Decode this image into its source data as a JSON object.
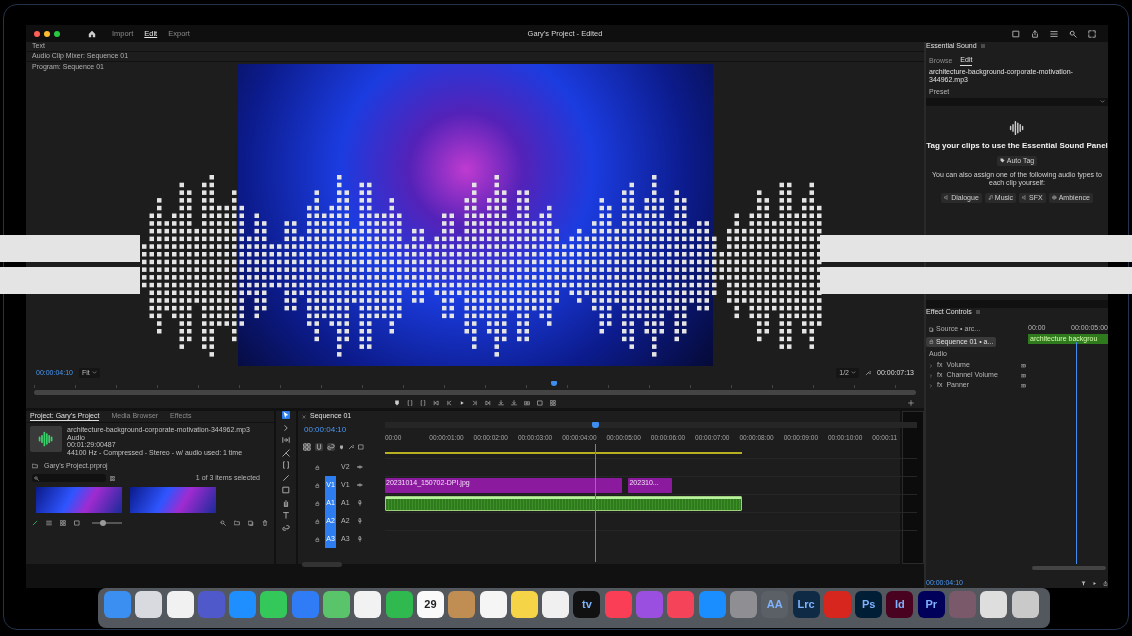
{
  "window": {
    "title": "Gary's Project - Edited"
  },
  "workspaces": [
    {
      "label": "Import",
      "selected": false
    },
    {
      "label": "Edit",
      "selected": true
    },
    {
      "label": "Export",
      "selected": false
    }
  ],
  "panel_headers": [
    "Text",
    "Audio Clip Mixer: Sequence 01",
    "Program: Sequence 01"
  ],
  "program_monitor": {
    "timecode": "00:00:04:10",
    "zoom": "Fit",
    "resolution": "1/2",
    "duration": "00:00:07:13",
    "playhead": {
      "level": 0.59
    }
  },
  "project": {
    "tabs": [
      {
        "label": "Project: Gary's Project",
        "selected": true
      },
      {
        "label": "Media Browser",
        "selected": false
      },
      {
        "label": "Effects",
        "selected": false
      }
    ],
    "clip_info": [
      "architecture-background-corporate-motivation-344962.mp3",
      "Audio",
      "00:01:29:00487",
      "44100 Hz - Compressed - Stereo - w/ audio used: 1 time"
    ],
    "bin": "Gary's Project.prproj",
    "count": "1 of 3 items selected",
    "zoom_slider": {
      "level": 0.35
    }
  },
  "timeline": {
    "title": "Sequence 01",
    "timecode": "00:00:04:10",
    "ruler": [
      "00:00",
      "00:00:01:00",
      "00:00:02:00",
      "00:00:03:00",
      "00:00:04:00",
      "00:00:05:00",
      "00:00:06:00",
      "00:00:07:00",
      "00:00:08:00",
      "00:00:09:00",
      "00:00:10:00",
      "00:00:11"
    ],
    "playhead": {
      "level": 0.395
    },
    "tracks": [
      {
        "kind": "video",
        "label": "V2"
      },
      {
        "kind": "video",
        "patch": "V1",
        "label": "V1",
        "clips": [
          {
            "kind": "video",
            "name": "20231014_150702-DPI.jpg"
          },
          {
            "kind": "video",
            "name": "202310..."
          }
        ]
      },
      {
        "kind": "audio",
        "patch": "A1",
        "label": "A1",
        "clips": [
          {
            "kind": "audio"
          }
        ]
      },
      {
        "kind": "audio",
        "patch": "A2",
        "label": "A2"
      },
      {
        "kind": "audio",
        "patch": "A3",
        "label": "A3"
      }
    ]
  },
  "essential_sound": {
    "title": "Essential Sound",
    "tabs": [
      {
        "label": "Browse",
        "selected": false
      },
      {
        "label": "Edit",
        "selected": true
      }
    ],
    "clip": "architecture-background-corporate-motivation-344962.mp3",
    "preset_label": "Preset",
    "heading": "Tag your clips to use the Essential Sound Panel",
    "auto_tag": "Auto Tag",
    "hint": "You can also assign one of the following audio types to each clip yourself:",
    "types": [
      "Dialogue",
      "Music",
      "SFX",
      "Ambience"
    ]
  },
  "effect_controls": {
    "title": "Effect Controls",
    "source": "Source • arc...",
    "sequence": "Sequence 01 • a...",
    "section": "Audio",
    "effects": [
      {
        "badge": "fx",
        "label": "Volume"
      },
      {
        "badge": "fx",
        "label": "Channel Volume"
      },
      {
        "badge": "fx",
        "label": "Panner"
      }
    ],
    "times": [
      "00:00",
      "00:00:05:00"
    ],
    "clip": "architecture backgrou",
    "timecode": "00:00:04:10",
    "playhead": {
      "level": 0.6
    }
  },
  "dock": [
    {
      "color": "#3b8ff0"
    },
    {
      "color": "#d9d9e0"
    },
    {
      "color": "#f1f1f1"
    },
    {
      "color": "#5059c9"
    },
    {
      "color": "#1f8fff"
    },
    {
      "color": "#34c759"
    },
    {
      "color": "#2f7cf6"
    },
    {
      "color": "#5ac46a"
    },
    {
      "color": "#f2f2f2"
    },
    {
      "color": "#30b94f"
    },
    {
      "color": "#fafafa",
      "label": "29"
    },
    {
      "color": "#c08e53"
    },
    {
      "color": "#f5f5f5"
    },
    {
      "color": "#f5d547"
    },
    {
      "color": "#f0f0f0"
    },
    {
      "color": "#111111",
      "label": "tv"
    },
    {
      "color": "#fa3e56"
    },
    {
      "color": "#9b4fe0"
    },
    {
      "color": "#f5435a"
    },
    {
      "color": "#1a8dff"
    },
    {
      "color": "#8e8e93"
    },
    {
      "color": "#5b5f66",
      "label": "AA"
    },
    {
      "color": "#0e2a44",
      "label": "Lrc"
    },
    {
      "color": "#d7261e"
    },
    {
      "color": "#001e36",
      "label": "Ps"
    },
    {
      "color": "#49021f",
      "label": "Id"
    },
    {
      "color": "#00005b",
      "label": "Pr"
    },
    {
      "color": "#7a5a6a"
    },
    {
      "color": "#dedede"
    },
    {
      "color": "#c9c9c9"
    }
  ]
}
